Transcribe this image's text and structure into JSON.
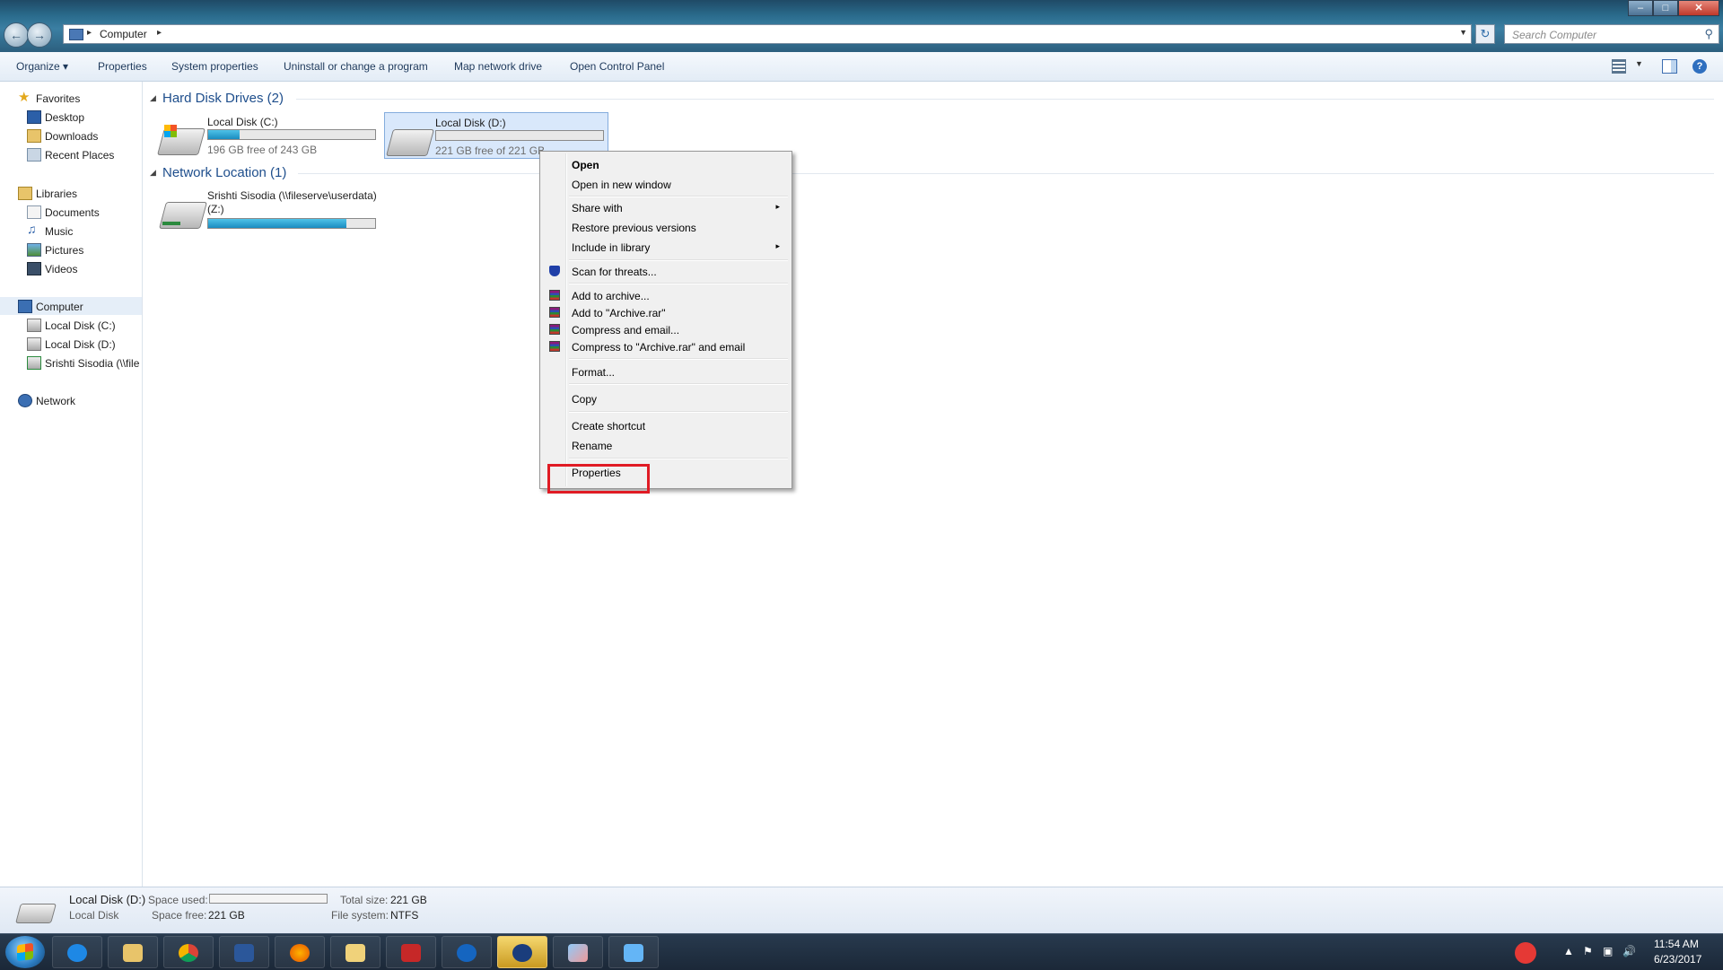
{
  "address": {
    "location": "Computer",
    "search_placeholder": "Search Computer"
  },
  "window_controls": {
    "minimize": "–",
    "maximize": "□",
    "close": "✕"
  },
  "toolbar": {
    "organize": "Organize ▾",
    "properties": "Properties",
    "system_properties": "System properties",
    "uninstall": "Uninstall or change a program",
    "map_drive": "Map network drive",
    "control_panel": "Open Control Panel"
  },
  "sidebar": {
    "favorites": "Favorites",
    "desktop": "Desktop",
    "downloads": "Downloads",
    "recent": "Recent Places",
    "libraries": "Libraries",
    "documents": "Documents",
    "music": "Music",
    "pictures": "Pictures",
    "videos": "Videos",
    "computer": "Computer",
    "disk_c": "Local Disk (C:)",
    "disk_d": "Local Disk (D:)",
    "net_share": "Srishti Sisodia (\\\\file",
    "network": "Network"
  },
  "content": {
    "hdd_group": "Hard Disk Drives (2)",
    "net_group": "Network Location (1)",
    "drive_c": {
      "name": "Local Disk (C:)",
      "free_text": "196 GB free of 243 GB",
      "used_fraction": 0.19
    },
    "drive_d": {
      "name": "Local Disk (D:)",
      "free_text": "221 GB free of 221 GB",
      "used_fraction": 0.0
    },
    "net_drive": {
      "name_line1": "Srishti Sisodia (\\\\fileserve\\userdata)",
      "name_line2": "(Z:)",
      "used_fraction": 0.83
    }
  },
  "context_menu": {
    "open": "Open",
    "open_new": "Open in new window",
    "share_with": "Share with",
    "restore": "Restore previous versions",
    "include_library": "Include in library",
    "scan": "Scan for threats...",
    "add_archive": "Add to archive...",
    "add_rar": "Add to \"Archive.rar\"",
    "compress_email": "Compress and email...",
    "compress_rar_email": "Compress to \"Archive.rar\" and email",
    "format": "Format...",
    "copy": "Copy",
    "create_shortcut": "Create shortcut",
    "rename": "Rename",
    "properties": "Properties",
    "submenu_arrow": "▸"
  },
  "details": {
    "name": "Local Disk (D:)",
    "type": "Local Disk",
    "space_used_label": "Space used:",
    "space_free_label": "Space free:",
    "space_free": "221 GB",
    "total_size_label": "Total size:",
    "total_size": "221 GB",
    "fs_label": "File system:",
    "fs": "NTFS",
    "used_fraction": 0.0
  },
  "taskbar": {
    "apps": [
      "internet-explorer",
      "file-explorer",
      "chrome",
      "word",
      "firefox",
      "folder",
      "acrobat",
      "outlook",
      "app-active",
      "paint",
      "remote-desktop"
    ],
    "time": "11:54 AM",
    "date": "6/23/2017"
  },
  "colors": {
    "highlight_box": "#e01b24",
    "selection": "#d9e8fb",
    "link_blue": "#1e4e8c"
  }
}
